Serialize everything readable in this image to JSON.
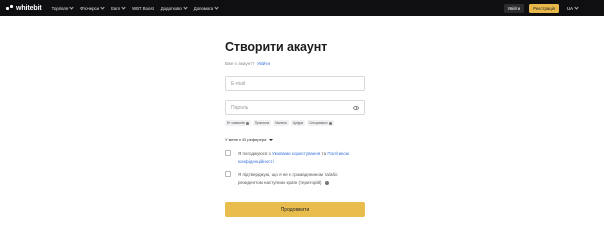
{
  "header": {
    "logo_text": "whitebit",
    "nav": [
      "Торгівля",
      "Ф'ючерси",
      "Earn",
      "WBT Boost",
      "Додатково",
      "Допомога"
    ],
    "login_label": "Увійти",
    "register_label": "Реєстрація",
    "language": "UA"
  },
  "form": {
    "title": "Створити акаунт",
    "have_account_text": "Вже є акаунт?",
    "login_link": "Увійти",
    "email_placeholder": "E-mail",
    "password_placeholder": "Пароль",
    "password_requirements": [
      "8+ символів",
      "Прописна",
      "Малена",
      "Цифра",
      "Спецсимвол"
    ],
    "referral_label": "У мене є ID реферера",
    "terms": {
      "prefix": "Я погоджуюся з",
      "terms_link": "Умовами користування",
      "conjunction": "та",
      "privacy_link": "Політикою конфіденційності"
    },
    "residency_text": "Я підтверджую, що я не є громадянином та/або резидентом наступних країн (територій)",
    "continue_label": "Продовжити"
  },
  "colors": {
    "accent": "#e9bd4d",
    "topbar": "#0f0f12",
    "link": "#3a73d9"
  }
}
